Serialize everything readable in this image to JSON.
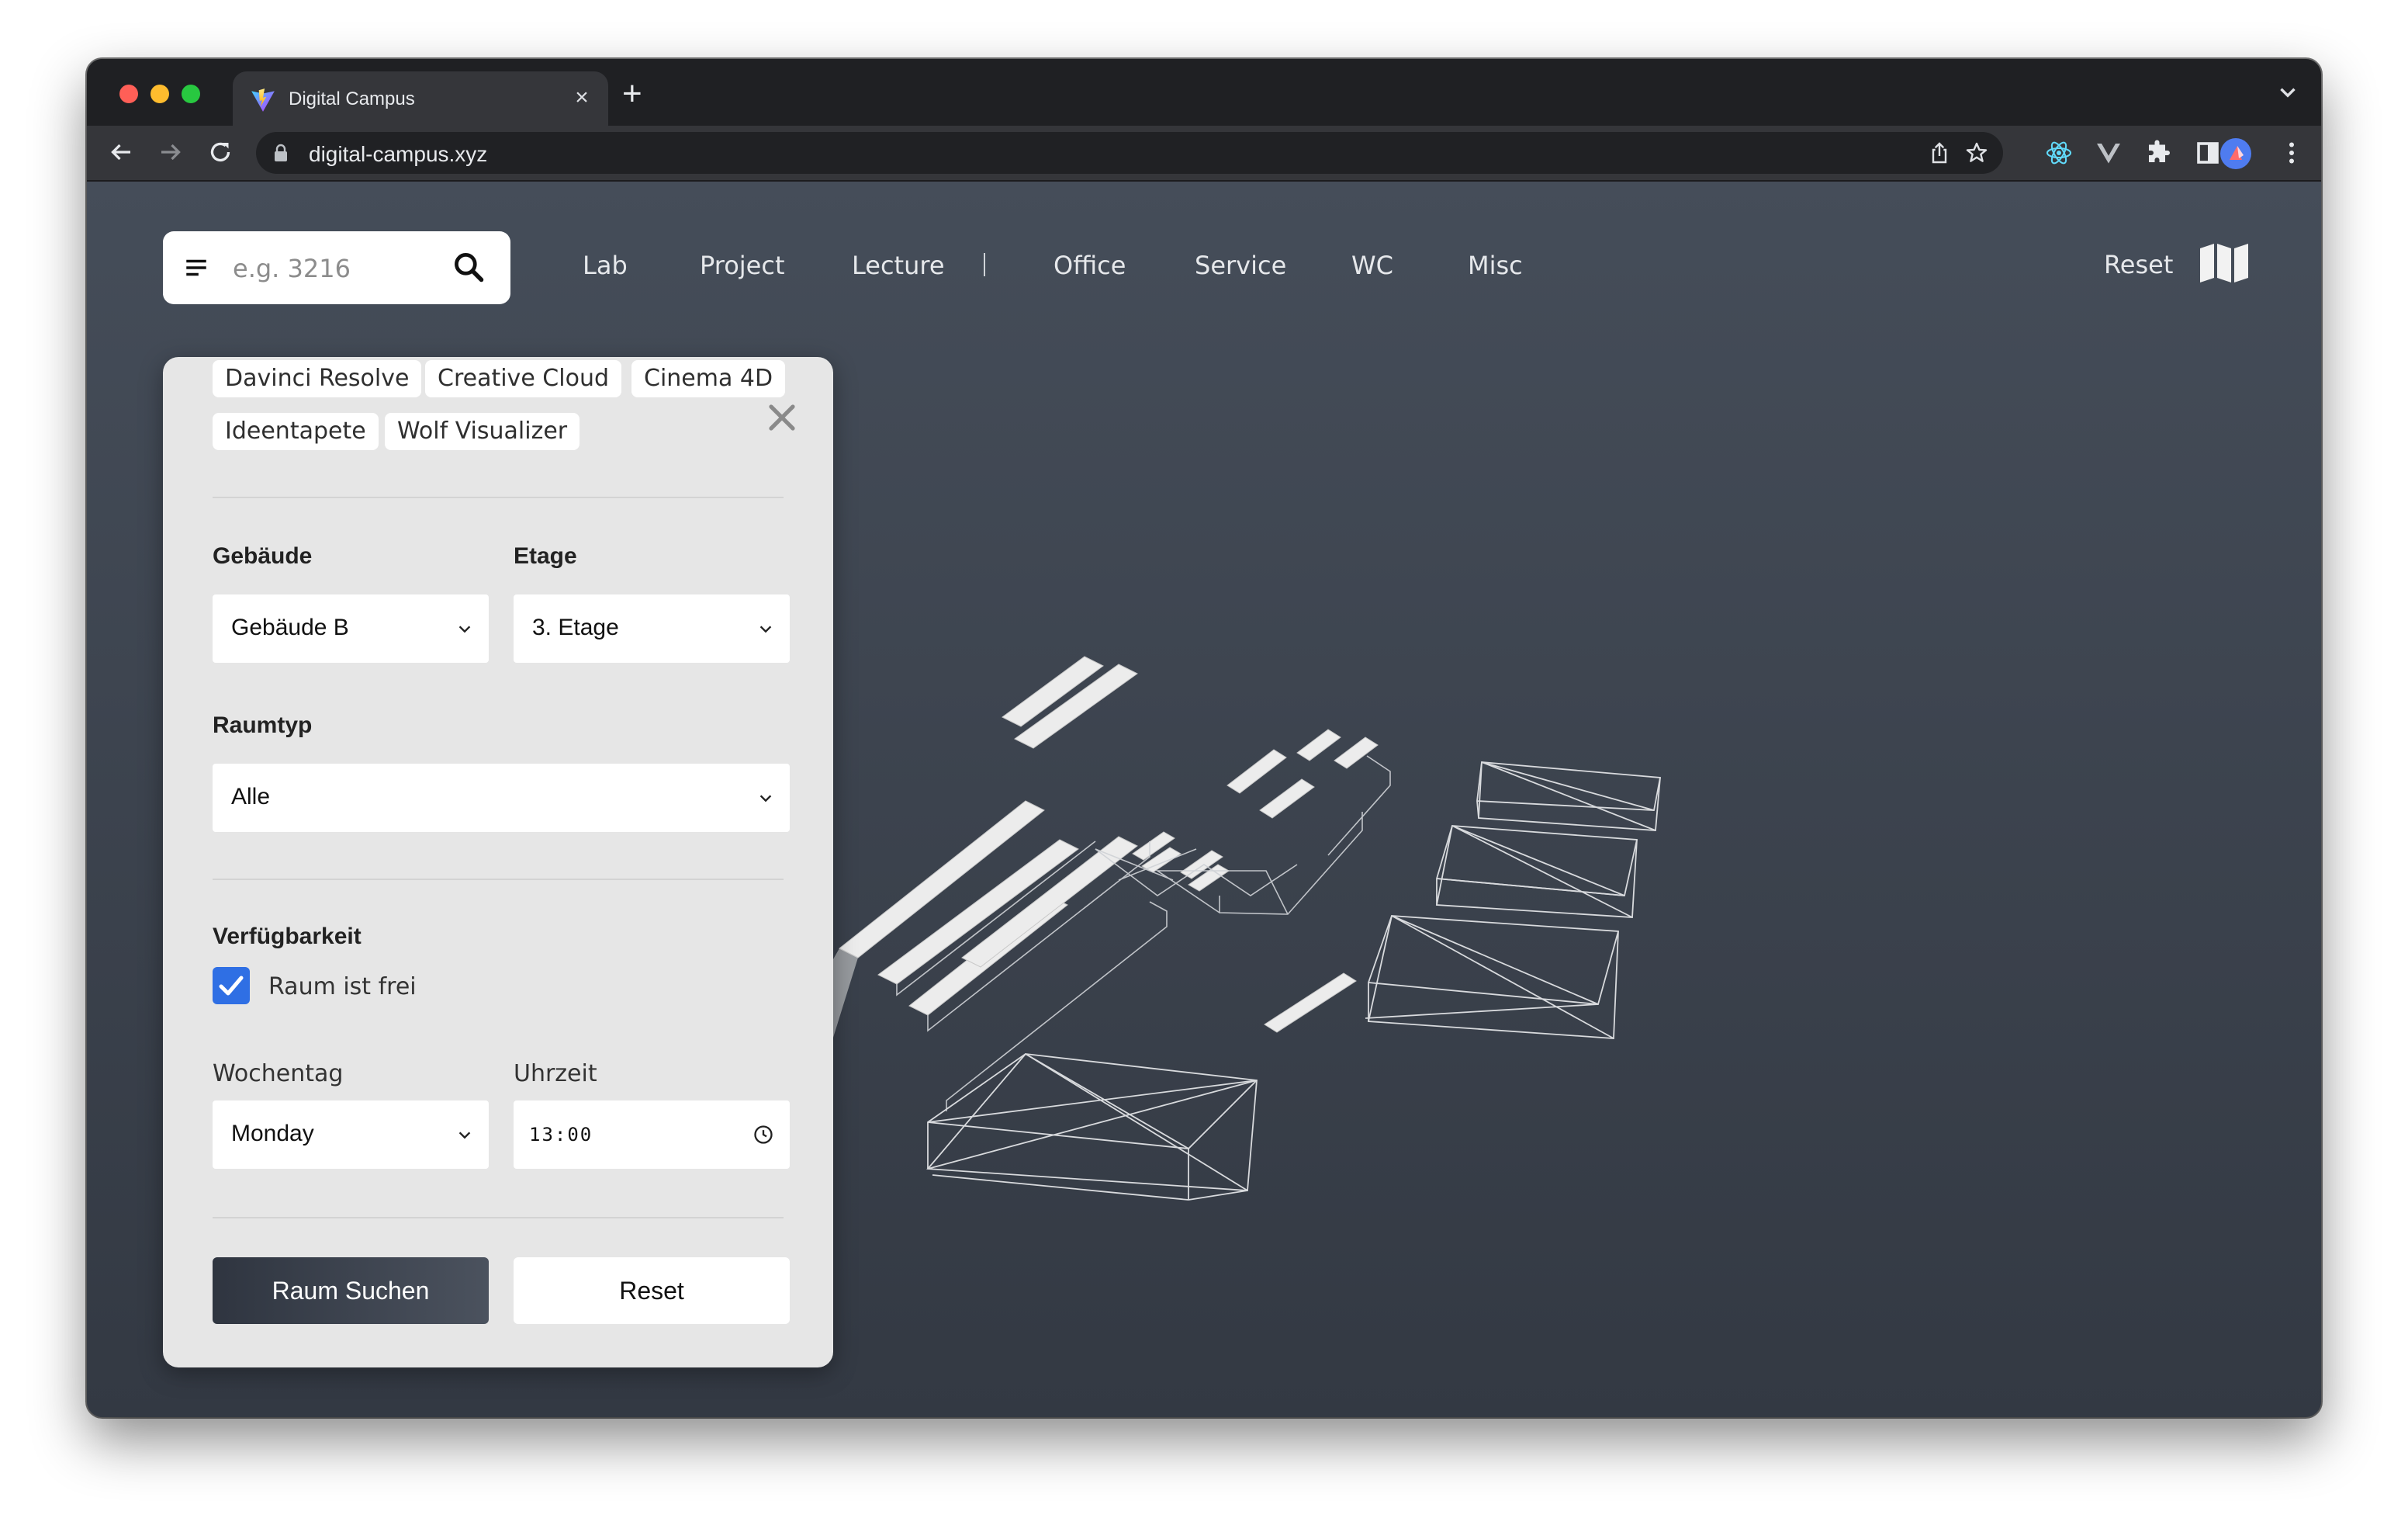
{
  "browser": {
    "tab_title": "Digital Campus",
    "tab_close": "×",
    "new_tab": "+",
    "url": "digital-campus.xyz"
  },
  "app": {
    "search": {
      "placeholder": "e.g. 3216"
    },
    "nav": [
      "Lab",
      "Project",
      "Lecture",
      "Office",
      "Service",
      "WC",
      "Misc"
    ],
    "reset_label": "Reset"
  },
  "panel": {
    "software_tags": [
      "Davinci Resolve",
      "Creative Cloud",
      "Cinema 4D",
      "Ideentapete",
      "Wolf Visualizer"
    ],
    "building": {
      "label": "Gebäude",
      "value": "Gebäude B"
    },
    "floor": {
      "label": "Etage",
      "value": "3. Etage"
    },
    "room_type": {
      "label": "Raumtyp",
      "value": "Alle"
    },
    "availability": {
      "label": "Verfügbarkeit",
      "checkbox_label": "Raum ist frei",
      "checked": true
    },
    "weekday": {
      "label": "Wochentag",
      "value": "Monday"
    },
    "time": {
      "label": "Uhrzeit",
      "value": "13:00"
    },
    "search_button": "Raum Suchen",
    "reset_button": "Reset"
  },
  "colors": {
    "accent": "#2f6fe4",
    "background_top": "#454d59",
    "background_bottom": "#333943",
    "panel": "#e6e6e6"
  }
}
